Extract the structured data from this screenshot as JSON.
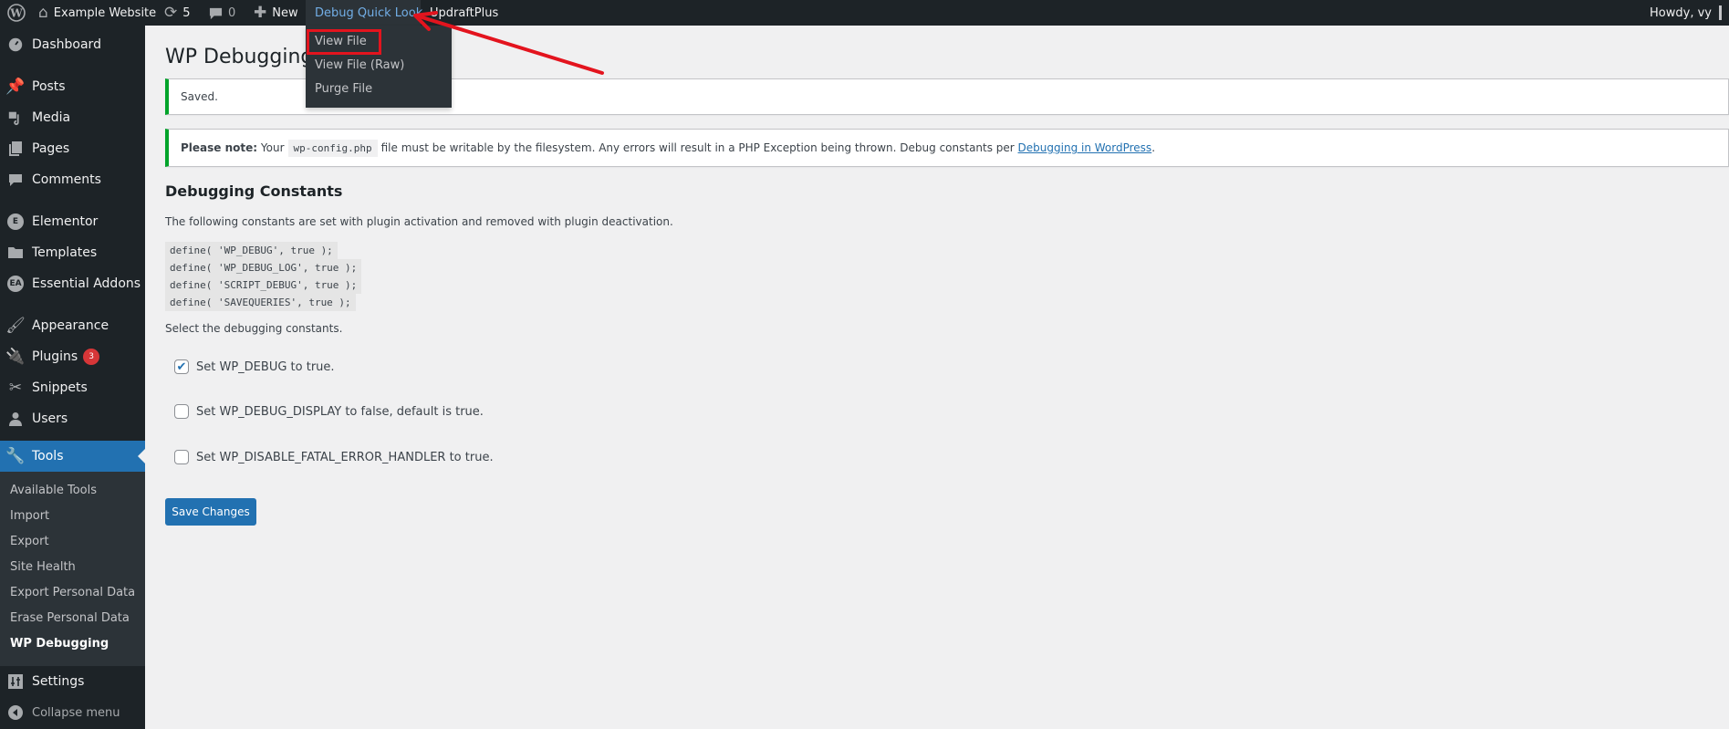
{
  "adminbar": {
    "site_name": "Example Website",
    "updates_count": "5",
    "comments_count": "0",
    "new_label": "New",
    "debug_quick_look": "Debug Quick Look",
    "updraftplus": "UpdraftPlus",
    "howdy": "Howdy, vy"
  },
  "dropdown": {
    "items": [
      {
        "label": "View File",
        "highlighted": true
      },
      {
        "label": "View File (Raw)"
      },
      {
        "label": "Purge File"
      }
    ]
  },
  "sidebar": {
    "items": [
      {
        "label": "Dashboard",
        "icon": "dashboard-icon"
      },
      {
        "label": "Posts",
        "icon": "pin-icon"
      },
      {
        "label": "Media",
        "icon": "media-icon"
      },
      {
        "label": "Pages",
        "icon": "pages-icon"
      },
      {
        "label": "Comments",
        "icon": "comment-icon"
      },
      {
        "label": "Elementor",
        "icon": "elementor-icon"
      },
      {
        "label": "Templates",
        "icon": "folder-icon"
      },
      {
        "label": "Essential Addons",
        "icon": "essential-addons-icon"
      },
      {
        "label": "Appearance",
        "icon": "paintbrush-icon"
      },
      {
        "label": "Plugins",
        "icon": "plug-icon",
        "badge": "3"
      },
      {
        "label": "Snippets",
        "icon": "scissors-icon"
      },
      {
        "label": "Users",
        "icon": "user-icon"
      },
      {
        "label": "Tools",
        "icon": "wrench-icon",
        "active": true
      },
      {
        "label": "Settings",
        "icon": "settings-icon"
      },
      {
        "label": "Collapse menu",
        "icon": "collapse-icon"
      }
    ],
    "submenu": [
      {
        "label": "Available Tools"
      },
      {
        "label": "Import"
      },
      {
        "label": "Export"
      },
      {
        "label": "Site Health"
      },
      {
        "label": "Export Personal Data"
      },
      {
        "label": "Erase Personal Data"
      },
      {
        "label": "WP Debugging",
        "current": true
      }
    ]
  },
  "main": {
    "page_title": "WP Debugging",
    "notice_saved": "Saved.",
    "notice_note": {
      "strong": "Please note:",
      "before_code": " Your",
      "code": "wp-config.php",
      "after_code": "file must be writable by the filesystem. Any errors will result in a PHP Exception being thrown. Debug constants per ",
      "link": "Debugging in WordPress",
      "end": "."
    },
    "section_title": "Debugging Constants",
    "intro": "The following constants are set with plugin activation and removed with plugin deactivation.",
    "code_lines": [
      "define( 'WP_DEBUG', true );",
      "define( 'WP_DEBUG_LOG', true );",
      "define( 'SCRIPT_DEBUG', true );",
      "define( 'SAVEQUERIES', true );"
    ],
    "select_label": "Select the debugging constants.",
    "checkboxes": [
      {
        "label": "Set WP_DEBUG to true.",
        "checked": true
      },
      {
        "label": "Set WP_DEBUG_DISPLAY to false, default is true.",
        "checked": false
      },
      {
        "label": "Set WP_DISABLE_FATAL_ERROR_HANDLER to true.",
        "checked": false
      }
    ],
    "save_label": "Save Changes"
  },
  "colors": {
    "adminbar_bg": "#1d2327",
    "accent": "#2271b1",
    "hover_link": "#72aee6",
    "success": "#00a32a",
    "badge": "#d63638",
    "annotation": "#e3141e"
  }
}
